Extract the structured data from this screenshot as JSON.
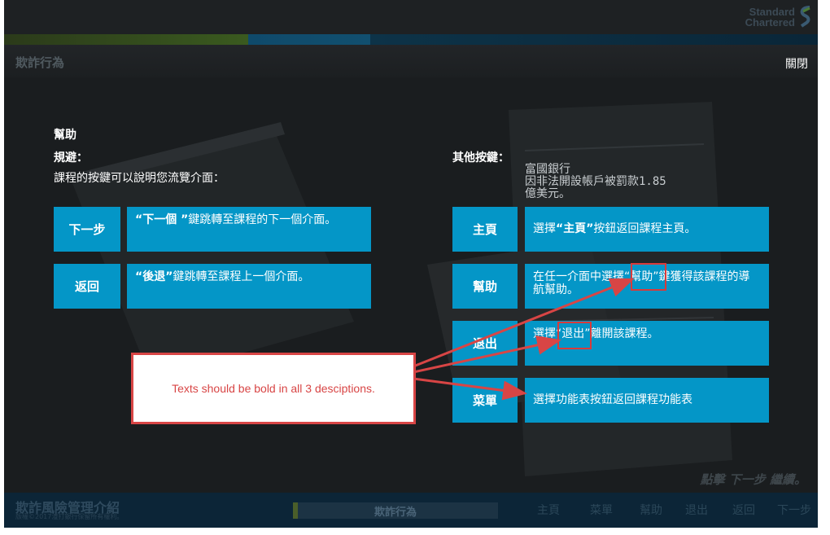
{
  "header": {
    "logo_line1": "Standard",
    "logo_line2": "Chartered",
    "section_title": "欺詐行為",
    "close_label": "關閉"
  },
  "help": {
    "title": "幫助",
    "nav_heading": "規避：",
    "nav_desc": "課程的按鍵可以說明您流覽介面：",
    "other_heading": "其他按鍵：",
    "news_text": [
      "富國銀行",
      "因非法開設帳戶被罰款1.85",
      "億美元。"
    ],
    "nav_keys": [
      {
        "key": "下一步",
        "desc_bold": "“下一個 ”",
        "desc_rest": "鍵跳轉至課程的下一個介面。"
      },
      {
        "key": "返回",
        "desc_bold": "“後退”",
        "desc_rest": "鍵跳轉至課程上一個介面。"
      }
    ],
    "other_keys": [
      {
        "key": "主頁",
        "desc_pre": "選擇",
        "desc_bold": "“主頁”",
        "desc_rest": "按鈕返回課程主頁。"
      },
      {
        "key": "幫助",
        "desc_pre": "在任一介面中選擇",
        "desc_bold": "“幫助”",
        "desc_rest": "鍵獲得該課程的導航幫助。"
      },
      {
        "key": "退出",
        "desc_pre": "選擇",
        "desc_bold": "“退出”",
        "desc_rest": "離開該課程。"
      },
      {
        "key": "菜單",
        "desc_pre": "選擇功能表按鈕返回課程功能表",
        "desc_bold": "",
        "desc_rest": ""
      }
    ]
  },
  "annotation": {
    "note_text": "Texts should be bold in all 3 desciptions.",
    "color": "#d84545"
  },
  "hint": "點擊 下一步 繼續。",
  "footer": {
    "course_title": "欺詐風險管理介紹",
    "copyright": "版權©2017渣打銀行保留所有權利。",
    "chapter": "欺詐行為",
    "nav": [
      "主頁",
      "菜單",
      "幫助",
      "退出",
      "返回",
      "下一步"
    ]
  },
  "colors": {
    "key_blue": "#0496c7",
    "background": "#1a1d1f",
    "bottom_bar": "#0c2537"
  }
}
